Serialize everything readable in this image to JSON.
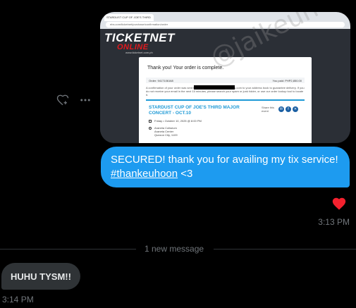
{
  "image_message": {
    "browser": {
      "tab_title": "STARDUST CUP OF JOE'S THIRD",
      "url": "ebs.com/ticketnet/purchase/confirmation/order"
    },
    "site": {
      "logo_top": "TICKETNET",
      "logo_bottom": "ONLINE",
      "logo_url": "www.ticketnet.com.ph"
    },
    "confirmation": {
      "title": "Thank you! Your order is complete.",
      "order_label": "Order: 9417106168",
      "paid_label": "You paid: PHP2,850.00",
      "body_text": "A confirmation of your order was sent to                    . Please add confirmation@ebs.com to your address book to guarantee delivery. If you do not receive your email in the next 15 minutes, please search your spam or junk folder, or use our order lookup tool to locate it.",
      "event_title": "STARDUST CUP OF JOE'S THIRD MAJOR CONCERT - OCT.10",
      "share_label": "Share this event",
      "date_line": "Friday • October 10, 2025 @ 8:00 PM",
      "venue_name": "Araneta Coliseum",
      "venue_place": "Araneta Center",
      "venue_city": "Quezon City, 1109"
    },
    "watermark": "@jaikeuhoon"
  },
  "sent_message": {
    "text_line1": "SECURED! thank you for availing my tix service!",
    "hashtag": "#thankeuhoon",
    "text_suffix": " <3",
    "timestamp": "3:13 PM",
    "reaction": "heart-icon"
  },
  "divider": {
    "label": "1 new message"
  },
  "received_message": {
    "text": "HUHU TYSM!!",
    "timestamp": "3:14 PM"
  },
  "colors": {
    "background": "#000000",
    "sent_bubble": "#1d9bf0",
    "received_bubble": "#2f3336",
    "heart": "#f91880",
    "muted_text": "#71767b"
  }
}
